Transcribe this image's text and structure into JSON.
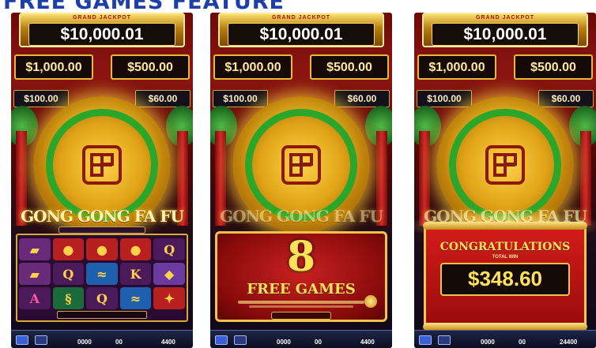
{
  "page_title": "FREE GAMES FEATURE",
  "panels": [
    {
      "grand_label": "GRAND JACKPOT",
      "grand": "$10,000.01",
      "major": "$1,000.00",
      "minor": "$500.00",
      "mini": "$100.00",
      "mini2": "$60.00",
      "logo": "GONG GONG FA FU",
      "symbols": [
        "ingot",
        "coin",
        "coin",
        "coin",
        "Q",
        "ingot",
        "Q",
        "fish",
        "K",
        "lantern",
        "A",
        "dragon",
        "Q",
        "fish",
        "ornament"
      ],
      "bottom": {
        "total": "0000",
        "bet": "00",
        "win": "4400"
      }
    },
    {
      "grand_label": "GRAND JACKPOT",
      "grand": "$10,000.01",
      "major": "$1,000.00",
      "minor": "$500.00",
      "mini": "$100.00",
      "mini2": "$60.00",
      "logo": "GONG GONG FA FU",
      "free_count": "8",
      "free_label": "FREE GAMES",
      "bottom": {
        "total": "0000",
        "bet": "00",
        "win": "4400"
      }
    },
    {
      "grand_label": "GRAND JACKPOT",
      "grand": "$10,000.01",
      "major": "$1,000.00",
      "minor": "$500.00",
      "mini": "$100.00",
      "mini2": "$60.00",
      "logo": "GONG GONG FA FU",
      "congrats": "CONGRATULATIONS",
      "win_label": "TOTAL WIN",
      "total_win": "$348.60",
      "bottom": {
        "total": "0000",
        "bet": "00",
        "win": "24400"
      }
    }
  ],
  "colors": {
    "title": "#1c3fa8",
    "green_ring": "#2aa62a",
    "gold": "#f2c24b",
    "red": "#c92121"
  }
}
